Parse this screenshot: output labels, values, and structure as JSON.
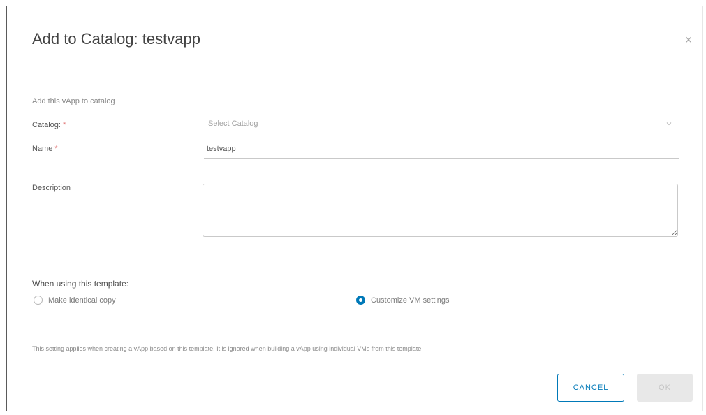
{
  "dialog": {
    "title": "Add to Catalog: testvapp",
    "close_glyph": "×",
    "subtitle": "Add this vApp to catalog"
  },
  "form": {
    "catalog": {
      "label": "Catalog:",
      "required_mark": "*",
      "placeholder": "Select Catalog"
    },
    "name": {
      "label": "Name",
      "required_mark": "*",
      "value": "testvapp"
    },
    "description": {
      "label": "Description",
      "value": ""
    }
  },
  "template_options": {
    "label": "When using this template:",
    "options": [
      {
        "label": "Make identical copy",
        "checked": false
      },
      {
        "label": "Customize VM settings",
        "checked": true
      }
    ],
    "note": "This setting applies when creating a vApp based on this template. It is ignored when building a vApp using individual VMs from this template."
  },
  "buttons": {
    "cancel": "CANCEL",
    "ok": "OK"
  },
  "colors": {
    "accent": "#0079b8",
    "required": "#e07272",
    "disabled_bg": "#e8e8e8"
  }
}
